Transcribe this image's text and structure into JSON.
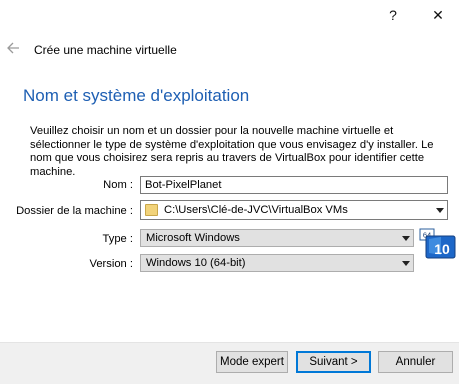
{
  "titlebar": {
    "help_label": "?",
    "close_label": "✕"
  },
  "wizard": {
    "title": "Crée une machine virtuelle",
    "section_heading": "Nom et système d'exploitation",
    "intro": "Veuillez choisir un nom et un dossier pour la nouvelle machine virtuelle et sélectionner le type de système d'exploitation que vous envisagez d'y installer. Le nom que vous choisirez sera repris au travers de VirtualBox pour identifier cette machine."
  },
  "form": {
    "name_label": "Nom :",
    "name_value": "Bot-PixelPlanet",
    "folder_label": "Dossier de la machine :",
    "folder_value": "C:\\Users\\Clé-de-JVC\\VirtualBox VMs",
    "type_label": "Type :",
    "type_value": "Microsoft Windows",
    "version_label": "Version :",
    "version_value": "Windows 10 (64-bit)"
  },
  "os_badge": {
    "bits": "64",
    "version": "10"
  },
  "buttons": {
    "expert": "Mode expert",
    "next": "Suivant >",
    "cancel": "Annuler"
  },
  "icons": {
    "back": "back-arrow-icon",
    "folder": "folder-icon",
    "dropdown": "chevron-down-icon",
    "os": "windows-10-64bit-icon"
  },
  "colors": {
    "heading": "#1e5fb3",
    "default_button_border": "#0078d7",
    "footer_bg": "#f0f0f0"
  }
}
